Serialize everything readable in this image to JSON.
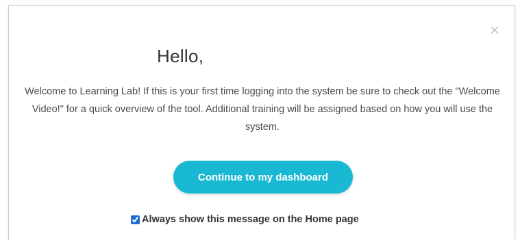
{
  "dialog": {
    "close_icon": "close-icon",
    "title": "Hello,",
    "message": "Welcome to Learning Lab! If this is your first time logging into the system be sure to check out the \"Welcome Video!\" for a quick overview of the tool. Additional training will be assigned based on how you will use the system.",
    "continue_button_label": "Continue to my dashboard",
    "always_show": {
      "label": "Always show this message on the Home page",
      "checked": true
    }
  },
  "colors": {
    "accent": "#19b9d4",
    "checkbox": "#1e6bd6",
    "text": "#4a4a4a",
    "border": "#c9c9c9"
  }
}
